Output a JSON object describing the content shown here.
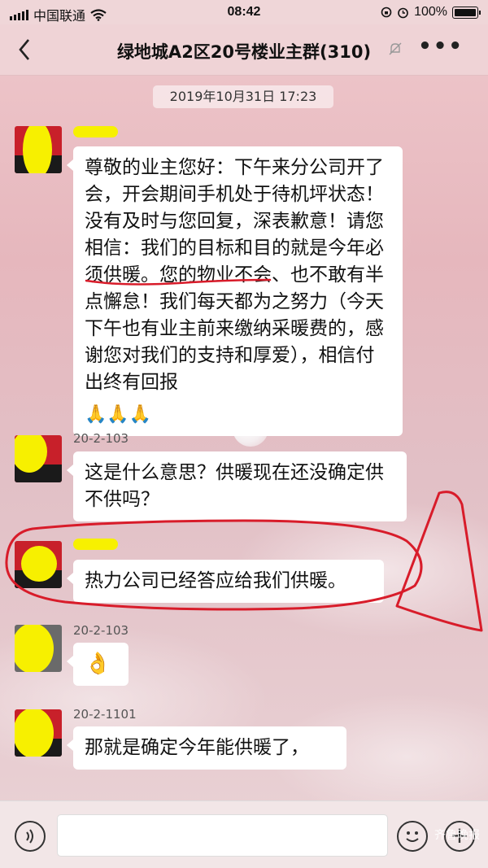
{
  "status_bar": {
    "carrier": "中国联通",
    "time": "08:42",
    "battery": "100%"
  },
  "header": {
    "title": "绿地城A2区20号楼业主群(310)",
    "back_icon": "chevron-left-icon",
    "more_icon": "more-dots-icon",
    "mute_icon": "bell-off-icon"
  },
  "timestamp": "2019年10月31日 17:23",
  "messages": [
    {
      "sender": "",
      "text": "尊敬的业主您好：下午来分公司开了会，开会期间手机处于待机坪状态！没有及时与您回复，深表歉意！请您相信：我们的目标和目的就是今年必须供暖。您的物业不会、也不敢有半点懈怠！我们每天都为之努力（今天下午也有业主前来缴纳采暖费的，感谢您对我们的支持和厚爱），相信付出终有回报",
      "emoji": "🙏🙏🙏"
    },
    {
      "sender": "20-2-103",
      "text": "这是什么意思？供暖现在还没确定供不供吗？"
    },
    {
      "sender": "",
      "text": "热力公司已经答应给我们供暖。"
    },
    {
      "sender": "20-2-103",
      "text": "👌"
    },
    {
      "sender": "20-2-1101",
      "text": "那就是确定今年能供暖了，"
    }
  ],
  "input_bar": {
    "voice_icon": "voice-icon",
    "emoji_icon": "smiley-icon",
    "plus_icon": "plus-icon",
    "plus_label": "+"
  },
  "watermark": "齐鲁晚报",
  "colors": {
    "annotation_red": "#d81c2a",
    "redaction_yellow": "#f7f000",
    "avatar_red": "#c8202a"
  }
}
